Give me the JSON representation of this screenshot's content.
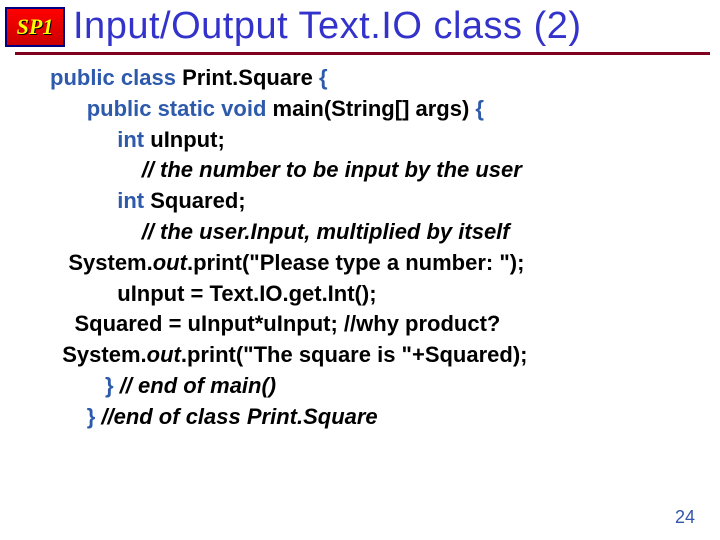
{
  "logo": "SP1",
  "title": "Input/Output Text.IO class (2)",
  "pagenum": "24",
  "code": {
    "l1_a": "public class",
    "l1_b": " Print.Square ",
    "l1_c": "{",
    "l2_a": "public static void",
    "l2_b": " main",
    "l2_c": "(String[] args) ",
    "l2_d": "{",
    "l3_a": "int",
    "l3_b": " uInput;",
    "l4": "// the number to be input by the user",
    "l5_a": "int",
    "l5_b": " Squared;",
    "l6": "// the user.Input, multiplied by itself",
    "l7_a": "System.",
    "l7_b": "out",
    "l7_c": ".",
    "l7_d": "print",
    "l7_e": "(\"Please type a number: \");",
    "l8": "uInput = Text.IO.get.Int();",
    "l9": "Squared = uInput*uInput; //why product?",
    "l10_a": "System.",
    "l10_b": "out",
    "l10_c": ".",
    "l10_d": "print",
    "l10_e": "(\"The square is \"+Squared);",
    "l11_a": "}",
    "l11_b": " // end of main()",
    "l12_a": "}",
    "l12_b": " //end of class Print.Square"
  }
}
